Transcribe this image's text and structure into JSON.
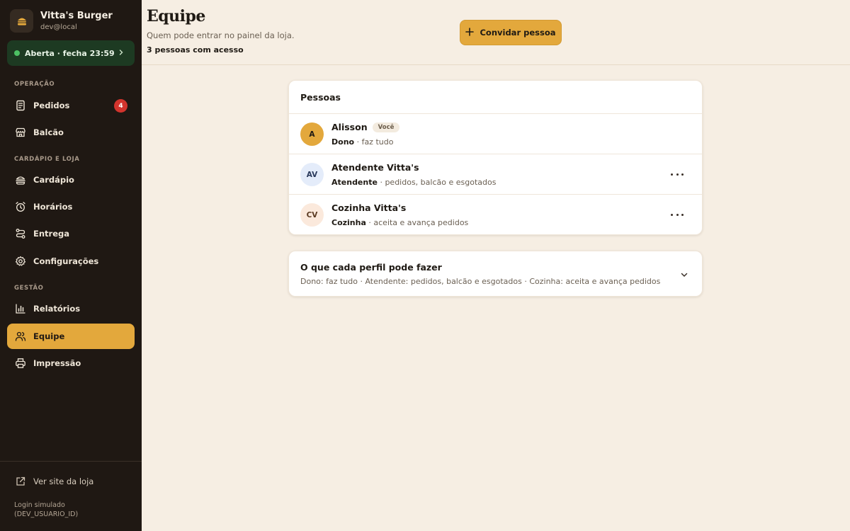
{
  "brand": {
    "name": "Vitta's Burger",
    "user": "dev@local"
  },
  "status": {
    "label": "Aberta · fecha 23:59",
    "color": "#4cc164"
  },
  "sidebar": {
    "sections": [
      "OPERAÇÃO",
      "CARDÁPIO E LOJA",
      "GESTÃO"
    ],
    "items": [
      {
        "label": "Pedidos",
        "icon": "receipt-icon",
        "badge": "4"
      },
      {
        "label": "Balcão",
        "icon": "store-icon"
      },
      {
        "label": "Cardápio",
        "icon": "burger-icon"
      },
      {
        "label": "Horários",
        "icon": "clock-icon"
      },
      {
        "label": "Entrega",
        "icon": "route-icon"
      },
      {
        "label": "Configurações",
        "icon": "gear-icon"
      },
      {
        "label": "Relatórios",
        "icon": "bar-chart-icon"
      },
      {
        "label": "Equipe",
        "icon": "users-icon",
        "active": true
      },
      {
        "label": "Impressão",
        "icon": "printer-icon"
      }
    ],
    "site_link": "Ver site da loja",
    "login_note": "Login simulado (DEV_USUARIO_ID)"
  },
  "header": {
    "title": "Equipe",
    "subtitle": "Quem pode entrar no painel da loja.",
    "count": "3 pessoas com acesso",
    "invite_label": "Convidar pessoa"
  },
  "people": {
    "title": "Pessoas",
    "rows": [
      {
        "initials": "A",
        "name": "Alisson",
        "tag": "Você",
        "role": "Dono",
        "desc": "· faz tudo",
        "avatar_bg": "#e3a83c",
        "avatar_fg": "#1f1a14"
      },
      {
        "initials": "AV",
        "name": "Atendente Vitta's",
        "role": "Atendente",
        "desc": "· pedidos, balcão e esgotados",
        "avatar_bg": "#e4ecfa",
        "avatar_fg": "#2a3a5c"
      },
      {
        "initials": "CV",
        "name": "Cozinha Vitta's",
        "role": "Cozinha",
        "desc": "· aceita e avança pedidos",
        "avatar_bg": "#fbe9dc",
        "avatar_fg": "#5a3a22"
      }
    ]
  },
  "roles": {
    "title": "O que cada perfil pode fazer",
    "desc": "Dono: faz tudo · Atendente: pedidos, balcão e esgotados · Cozinha: aceita e avança pedidos"
  },
  "colors": {
    "accent": "#e3a83c",
    "sidebar_bg": "#1f1813",
    "page_bg": "#f6eee3",
    "badge": "#d3342d"
  }
}
